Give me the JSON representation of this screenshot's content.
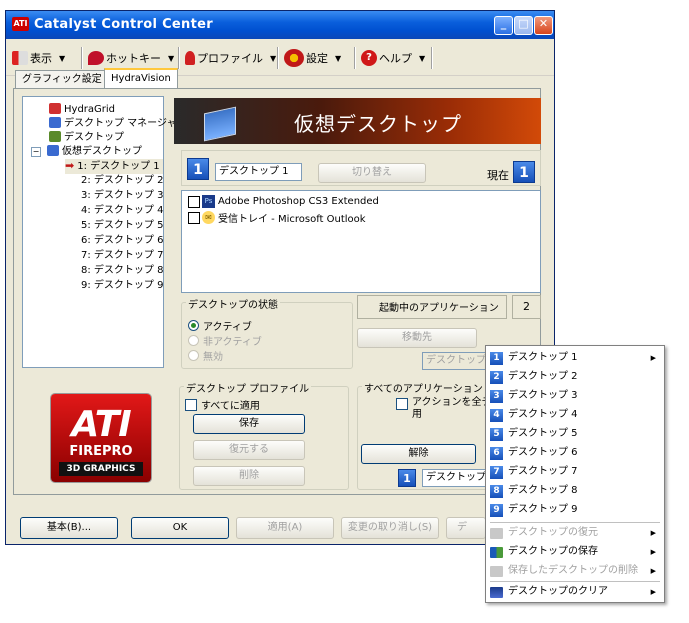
{
  "window": {
    "title": "Catalyst Control Center"
  },
  "toolbar": {
    "view": "表示",
    "hotkeys": "ホットキー",
    "profiles": "プロファイル",
    "settings": "設定",
    "help": "ヘルプ"
  },
  "tabs": [
    "グラフィック設定",
    "HydraVision"
  ],
  "tree": {
    "items": [
      "HydraGrid",
      "デスクトップ マネージャ",
      "デスクトップ",
      "仮想デスクトップ"
    ],
    "desktops": [
      "1: デスクトップ 1",
      "2: デスクトップ 2",
      "3: デスクトップ 3",
      "4: デスクトップ 4",
      "5: デスクトップ 5",
      "6: デスクトップ 6",
      "7: デスクトップ 7",
      "8: デスクトップ 8",
      "9: デスクトップ 9"
    ]
  },
  "banner": {
    "title": "仮想デスクトップ"
  },
  "desktop": {
    "number": "1",
    "name": "デスクトップ 1",
    "switch_button": "切り替え",
    "current_label": "現在",
    "current_number": "1"
  },
  "apps": [
    {
      "badge": "Ps",
      "label": "Adobe Photoshop CS3 Extended"
    },
    {
      "badge": "✉",
      "label": "受信トレイ - Microsoft Outlook"
    }
  ],
  "state": {
    "group_label": "デスクトップの状態",
    "options": [
      "アクティブ",
      "非アクティブ",
      "無効"
    ],
    "selected": "アクティブ"
  },
  "running": {
    "label": "起動中のアプリケーション",
    "count": "2",
    "move_button": "移動先",
    "target_field": "デスクトップ 2"
  },
  "profile": {
    "group_label": "デスクトップ プロファイル",
    "apply_all": "すべてに適用",
    "save": "保存",
    "restore": "復元する",
    "delete": "削除"
  },
  "all_apps": {
    "group_label": "すべてのアプリケーション",
    "action_label_1": "アクションを全デス",
    "action_label_2": "用",
    "release": "解除",
    "number": "1",
    "field": "デスクトップ 1"
  },
  "logo": {
    "brand": "ATI",
    "sub": "FIREPRO",
    "tag": "3D GRAPHICS"
  },
  "bottom": {
    "basic": "基本(B)...",
    "ok": "OK",
    "apply": "適用(A)",
    "discard": "変更の取り消し(S)",
    "partial": "デ"
  },
  "context_menu": {
    "desktops": [
      "デスクトップ 1",
      "デスクトップ 2",
      "デスクトップ 3",
      "デスクトップ 4",
      "デスクトップ 5",
      "デスクトップ 6",
      "デスクトップ 7",
      "デスクトップ 8",
      "デスクトップ 9"
    ],
    "restore": "デスクトップの復元",
    "save": "デスクトップの保存",
    "delete_saved": "保存したデスクトップの削除",
    "clear": "デスクトップのクリア"
  }
}
